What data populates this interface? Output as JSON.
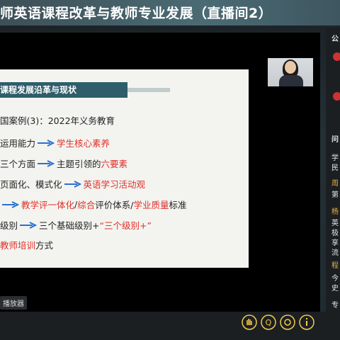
{
  "title": "师英语课程改革与教师专业发展（直播间2）",
  "slide": {
    "header": "课程发展沿革与现状",
    "lines": [
      {
        "text": "国案例(3)：2022年义务教育"
      },
      {
        "pre": "运用能力",
        "post_red": "学生核心素养"
      },
      {
        "pre": "三个方面",
        "post": "主题引领的",
        "post_red2": "六要素"
      },
      {
        "pre": "页面化、模式化",
        "post_red": "英语学习活动观"
      },
      {
        "pre_red": "教学评一体化",
        "mid": "/",
        "mid_red": "综合",
        "mid2": "评价体系/",
        "mid_red2": "学业质量",
        "tail": "标准"
      },
      {
        "pre": "级别",
        "post": "三个基础级别+",
        "post_red": "“三个级别+”"
      },
      {
        "pre_red": "教师培训",
        "tail": "方式"
      }
    ]
  },
  "right_panel": {
    "label1": "公",
    "label2": "问",
    "text1": "学",
    "text2": "民",
    "text3": "周",
    "text4": "第",
    "text5": "杨",
    "text6": "英",
    "text7": "极",
    "text8": "享",
    "text9": "流",
    "text10": "程",
    "text11": "今",
    "text12": "史",
    "text13": "专"
  },
  "player_label": "播放器",
  "colors": {
    "accent": "#2f5e6a",
    "red": "#e0302c",
    "arrow": "#2d6fd1"
  }
}
